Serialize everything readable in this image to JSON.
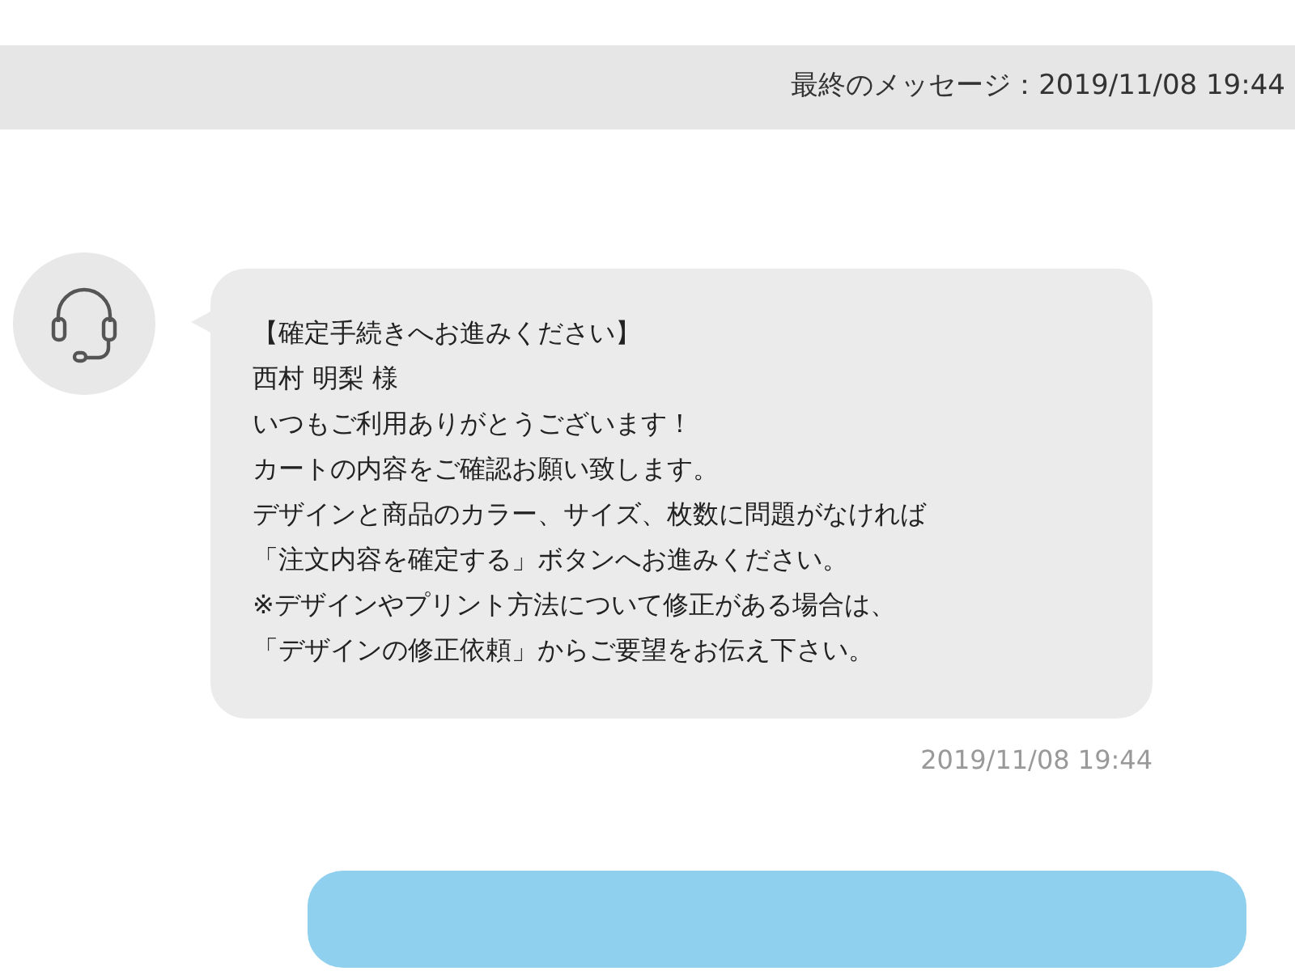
{
  "header": {
    "last_message": "最終のメッセージ：2019/11/08 19:44"
  },
  "messages": [
    {
      "kind": "received",
      "lines": [
        "【確定手続きへお進みください】",
        "西村 明梨 様",
        "いつもご利用ありがとうございます！",
        "カートの内容をご確認お願い致します。",
        "デザインと商品のカラー、サイズ、枚数に問題がなければ",
        "「注文内容を確定する」ボタンへお進みください。",
        "※デザインやプリント方法について修正がある場合は、",
        "「デザインの修正依頼」からご要望をお伝え下さい。"
      ],
      "time": "2019/11/08 19:44"
    },
    {
      "kind": "sent"
    }
  ]
}
